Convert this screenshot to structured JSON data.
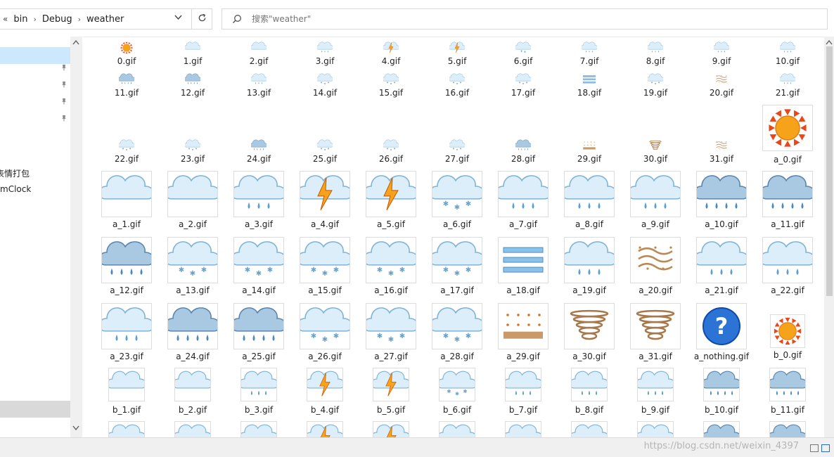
{
  "address_bar": {
    "back_chevrons": "«",
    "crumbs": [
      "bin",
      "Debug",
      "weather"
    ],
    "dropdown_icon": "chevron-down-icon",
    "refresh_icon": "refresh-icon"
  },
  "search": {
    "placeholder": "搜索\"weather\"",
    "icon": "search-icon"
  },
  "sidebar": {
    "items": [
      {
        "label": "",
        "pinned": true
      },
      {
        "label": "",
        "pinned": true
      },
      {
        "label": "",
        "pinned": true
      },
      {
        "label": "",
        "pinned": true
      },
      {
        "label": "表情打包",
        "pinned": false
      },
      {
        "label": "mClock",
        "pinned": false
      }
    ]
  },
  "files": {
    "small_rows": [
      [
        "0.gif",
        "1.gif",
        "2.gif",
        "3.gif",
        "4.gif",
        "5.gif",
        "6.gif",
        "7.gif",
        "8.gif",
        "9.gif",
        "10.gif"
      ],
      [
        "11.gif",
        "12.gif",
        "13.gif",
        "14.gif",
        "15.gif",
        "16.gif",
        "17.gif",
        "18.gif",
        "19.gif",
        "20.gif",
        "21.gif"
      ],
      [
        "22.gif",
        "23.gif",
        "24.gif",
        "25.gif",
        "26.gif",
        "27.gif",
        "28.gif",
        "29.gif",
        "30.gif",
        "31.gif",
        "a_0.gif"
      ]
    ],
    "large_rows": [
      [
        "a_1.gif",
        "a_2.gif",
        "a_3.gif",
        "a_4.gif",
        "a_5.gif",
        "a_6.gif",
        "a_7.gif",
        "a_8.gif",
        "a_9.gif",
        "a_10.gif",
        "a_11.gif"
      ],
      [
        "a_12.gif",
        "a_13.gif",
        "a_14.gif",
        "a_15.gif",
        "a_16.gif",
        "a_17.gif",
        "a_18.gif",
        "a_19.gif",
        "a_20.gif",
        "a_21.gif",
        "a_22.gif"
      ],
      [
        "a_23.gif",
        "a_24.gif",
        "a_25.gif",
        "a_26.gif",
        "a_27.gif",
        "a_28.gif",
        "a_29.gif",
        "a_30.gif",
        "a_31.gif",
        "a_nothing.gif",
        "b_0.gif"
      ]
    ],
    "medium_row": [
      "b_1.gif",
      "b_2.gif",
      "b_3.gif",
      "b_4.gif",
      "b_5.gif",
      "b_6.gif",
      "b_7.gif",
      "b_8.gif",
      "b_9.gif",
      "b_10.gif",
      "b_11.gif"
    ],
    "icon_types": {
      "small_rows": [
        [
          "sun",
          "partly-cloudy",
          "cloudy",
          "rain",
          "thunder",
          "thunder",
          "rain-snow",
          "rain",
          "rain",
          "rain",
          "rain"
        ],
        [
          "heavy-rain",
          "heavy-rain",
          "rain",
          "snow",
          "snow",
          "snow",
          "snow",
          "fog",
          "snow",
          "dust",
          "rain"
        ],
        [
          "snow",
          "snow",
          "heavy-rain",
          "snow",
          "snow",
          "snow",
          "heavy-rain",
          "sand",
          "tornado",
          "dust",
          "sun"
        ]
      ],
      "large_rows": [
        [
          "partly-cloudy",
          "cloudy",
          "rain",
          "thunder",
          "thunder",
          "snow",
          "rain",
          "rain",
          "rain",
          "heavy-rain",
          "heavy-rain"
        ],
        [
          "heavy-rain",
          "snow",
          "snow",
          "snow",
          "snow",
          "snow",
          "fog",
          "rain",
          "dust",
          "rain",
          "rain"
        ],
        [
          "rain",
          "heavy-rain",
          "heavy-rain",
          "snow",
          "snow",
          "snow",
          "sand",
          "tornado",
          "tornado",
          "question",
          "sun"
        ]
      ],
      "medium_row": [
        "partly-cloudy",
        "cloudy",
        "rain",
        "thunder",
        "thunder",
        "snow",
        "rain",
        "rain",
        "rain",
        "heavy-rain",
        "heavy-rain"
      ]
    }
  },
  "watermark": "https://blog.csdn.net/weixin_4397",
  "colors": {
    "selection": "#cce8ff",
    "cloud_fill": "#dceef9",
    "cloud_stroke": "#7fb3d5",
    "sun": "#f7a21b",
    "drop": "#5b9fd0"
  }
}
